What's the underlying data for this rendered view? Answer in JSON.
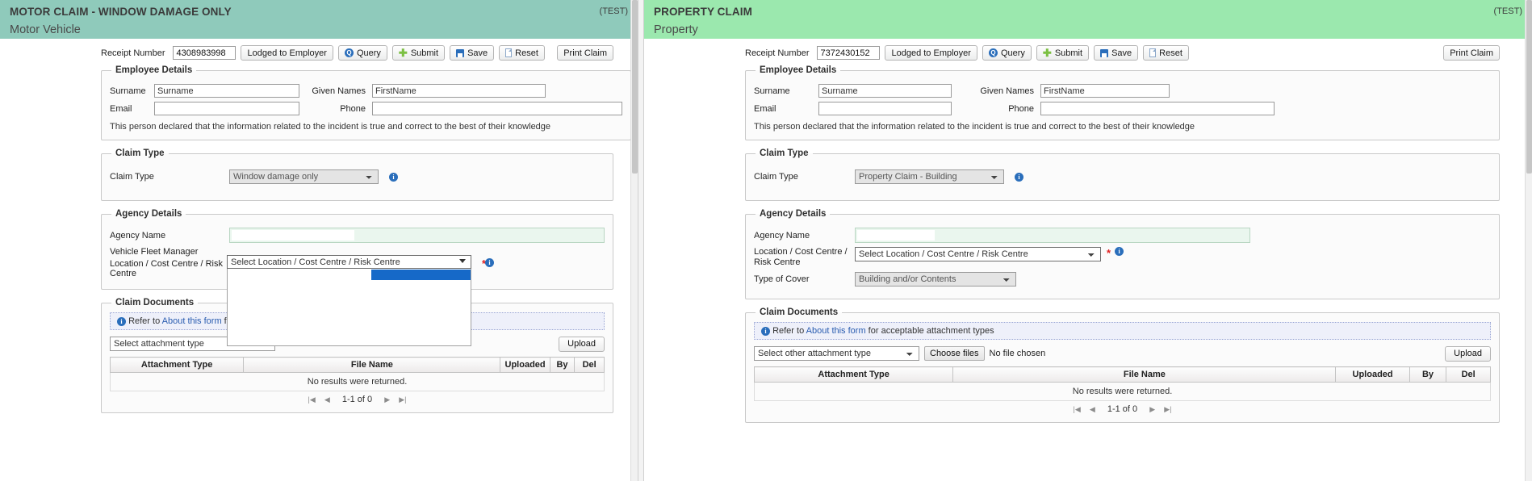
{
  "left_pane": {
    "banner": {
      "title": "MOTOR CLAIM - WINDOW DAMAGE ONLY",
      "subtitle": "Motor Vehicle",
      "env_tag": "(TEST)"
    },
    "toolbar": {
      "receipt_label": "Receipt Number",
      "receipt_value": "4308983998",
      "lodged_label": "Lodged to Employer",
      "query_label": "Query",
      "submit_label": "Submit",
      "save_label": "Save",
      "reset_label": "Reset",
      "print_label": "Print Claim"
    },
    "employee_details": {
      "legend": "Employee Details",
      "surname_label": "Surname",
      "surname_value": "Surname",
      "given_label": "Given Names",
      "given_value": "FirstName",
      "email_label": "Email",
      "email_value": "",
      "phone_label": "Phone",
      "phone_value": "",
      "declaration": "This person declared that the information related to the incident is true and correct to the best of their knowledge"
    },
    "claim_type": {
      "legend": "Claim Type",
      "label": "Claim Type",
      "value": "Window damage only"
    },
    "agency_details": {
      "legend": "Agency Details",
      "agency_name_label": "Agency Name",
      "agency_name_value": "",
      "fleet_manager_label": "Vehicle Fleet Manager",
      "fleet_manager_value": "",
      "location_label": "Location / Cost Centre / Risk Centre",
      "location_value": "Select Location / Cost Centre / Risk Centre",
      "required_mark": "*"
    },
    "claim_documents": {
      "legend": "Claim Documents",
      "note_prefix": "Refer to ",
      "note_link": "About this form",
      "note_suffix": " for acceptable attachment types",
      "attachment_select_value": "Select attachment type",
      "upload_label": "Upload",
      "columns": [
        "Attachment Type",
        "File Name",
        "Uploaded",
        "By",
        "Del"
      ],
      "empty_message": "No results were returned.",
      "pager_text": "1-1 of 0"
    }
  },
  "right_pane": {
    "banner": {
      "title": "PROPERTY CLAIM",
      "subtitle": "Property",
      "env_tag": "(TEST)"
    },
    "toolbar": {
      "receipt_label": "Receipt Number",
      "receipt_value": "7372430152",
      "lodged_label": "Lodged to Employer",
      "query_label": "Query",
      "submit_label": "Submit",
      "save_label": "Save",
      "reset_label": "Reset",
      "print_label": "Print Claim"
    },
    "employee_details": {
      "legend": "Employee Details",
      "surname_label": "Surname",
      "surname_value": "Surname",
      "given_label": "Given Names",
      "given_value": "FirstName",
      "email_label": "Email",
      "email_value": "",
      "phone_label": "Phone",
      "phone_value": "",
      "declaration": "This person declared that the information related to the incident is true and correct to the best of their knowledge"
    },
    "claim_type": {
      "legend": "Claim Type",
      "label": "Claim Type",
      "value": "Property Claim - Building"
    },
    "agency_details": {
      "legend": "Agency Details",
      "agency_name_label": "Agency Name",
      "agency_name_value": "",
      "location_label": "Location / Cost Centre / Risk Centre",
      "location_value": "Select Location / Cost Centre / Risk Centre",
      "required_mark": "*",
      "cover_label": "Type of Cover",
      "cover_value": "Building and/or Contents"
    },
    "claim_documents": {
      "legend": "Claim Documents",
      "note_prefix": "Refer to ",
      "note_link": "About this form",
      "note_suffix": " for acceptable attachment types",
      "attachment_select_value": "Select other attachment type",
      "choose_files_label": "Choose files",
      "no_file_text": "No file chosen",
      "upload_label": "Upload",
      "columns": [
        "Attachment Type",
        "File Name",
        "Uploaded",
        "By",
        "Del"
      ],
      "empty_message": "No results were returned.",
      "pager_text": "1-1 of 0"
    }
  },
  "colors": {
    "motor_banner": "#8fcabb",
    "property_banner": "#9be8ae",
    "accent_blue": "#2a6ebb",
    "highlight_blue": "#1669c8",
    "required_red": "#e02020"
  }
}
